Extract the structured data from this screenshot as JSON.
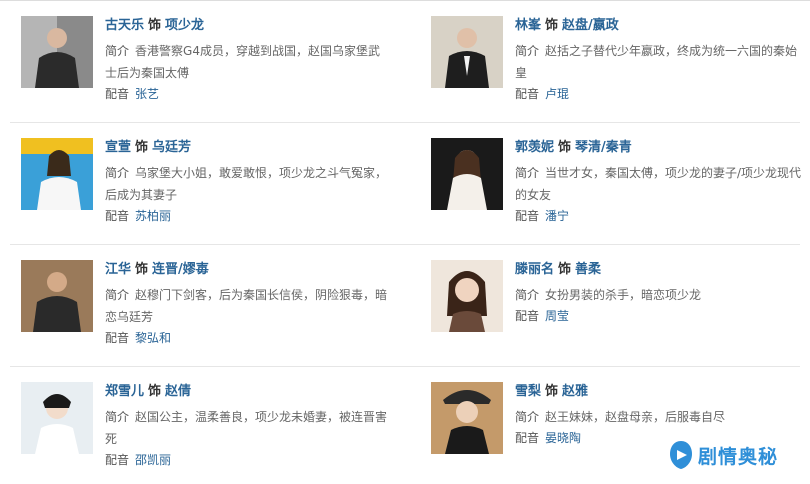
{
  "label_intro": "简介",
  "label_dub": "配音",
  "label_as": "饰",
  "watermark_text": "剧情奥秘",
  "entries": [
    {
      "actor": "古天乐",
      "role": "项少龙",
      "intro": "香港警察G4成员，穿越到战国，赵国乌家堡武士后为秦国太傅",
      "dub": "张艺"
    },
    {
      "actor": "林峯",
      "role": "赵盘/嬴政",
      "intro": "赵括之子替代少年嬴政，终成为统一六国的秦始皇",
      "dub": "卢琨"
    },
    {
      "actor": "宣萱",
      "role": "乌廷芳",
      "intro": "乌家堡大小姐，敢爱敢恨，项少龙之斗气冤家，后成为其妻子",
      "dub": "苏柏丽"
    },
    {
      "actor": "郭羡妮",
      "role": "琴清/秦青",
      "intro": "当世才女，秦国太傅，项少龙的妻子/项少龙现代的女友",
      "dub": "潘宁"
    },
    {
      "actor": "江华",
      "role": "连晋/嫪毐",
      "intro": "赵穆门下剑客，后为秦国长信侯，阴险狠毒，暗恋乌廷芳",
      "dub": "黎弘和"
    },
    {
      "actor": "滕丽名",
      "role": "善柔",
      "intro": "女扮男装的杀手，暗恋项少龙",
      "dub": "周莹"
    },
    {
      "actor": "郑雪儿",
      "role": "赵倩",
      "intro": "赵国公主，温柔善良，项少龙未婚妻，被连晋害死",
      "dub": "邵凯丽"
    },
    {
      "actor": "雪梨",
      "role": "赵雅",
      "intro": "赵王妹妹，赵盘母亲，后服毒自尽",
      "dub": "晏晓陶"
    }
  ]
}
